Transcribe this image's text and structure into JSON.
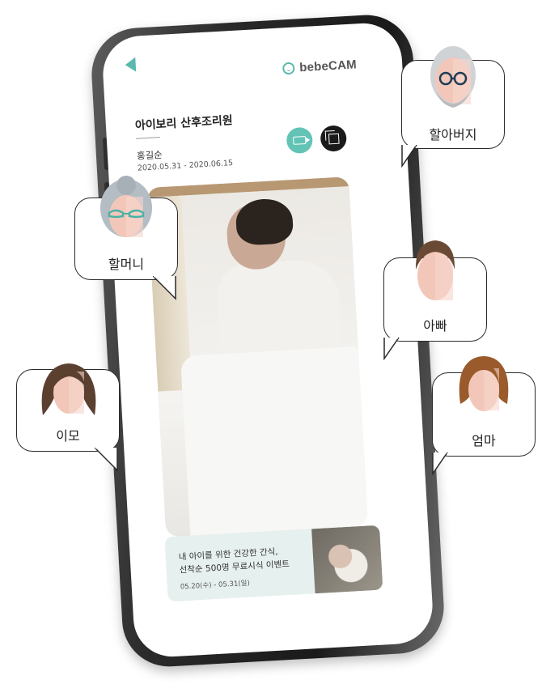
{
  "app": {
    "logo_text": "bebeCAM",
    "facility_name": "아이보리 산후조리원",
    "guardian_name": "홍길순",
    "stay_period": "2020.05.31 - 2020.06.15"
  },
  "icons": {
    "back": "back-arrow-icon",
    "logo": "bebecam-logo-icon",
    "camera": "video-camera-icon",
    "gallery": "gallery-icon"
  },
  "banner": {
    "line1": "내 아이를 위한 건강한 간식,",
    "line2": "선착순 500명 무료시식 이벤트",
    "date": "05.20(수) - 05.31(일)"
  },
  "family": [
    {
      "id": "grandfather",
      "label": "할아버지"
    },
    {
      "id": "grandmother",
      "label": "할머니"
    },
    {
      "id": "dad",
      "label": "아빠"
    },
    {
      "id": "aunt",
      "label": "이모"
    },
    {
      "id": "mom",
      "label": "엄마"
    }
  ],
  "colors": {
    "accent": "#5bb8ad",
    "dark_button": "#1a1a1a",
    "banner_bg": "#e6f0ee"
  }
}
